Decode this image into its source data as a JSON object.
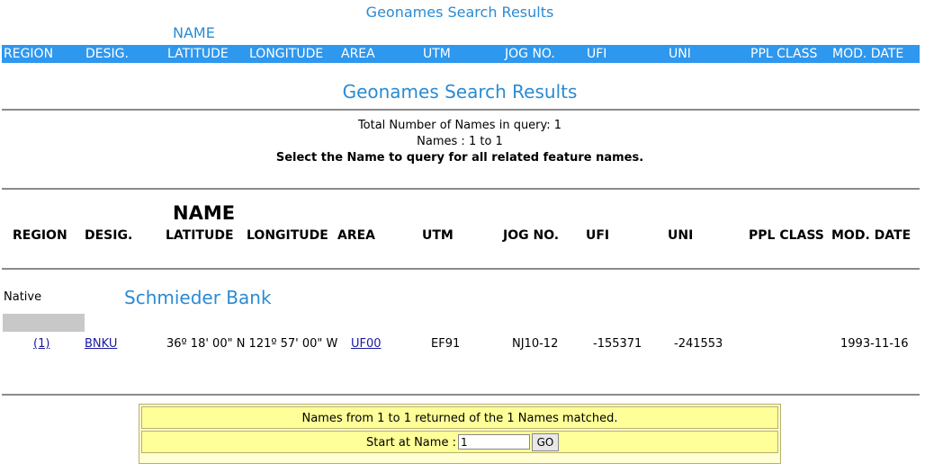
{
  "top": {
    "title": "Geonames Search Results",
    "name_label": "NAME",
    "columns": [
      "REGION",
      "DESIG.",
      "LATITUDE",
      "LONGITUDE",
      "AREA",
      "UTM",
      "JOG NO.",
      "UFI",
      "UNI",
      "PPL CLASS",
      "MOD. DATE"
    ]
  },
  "main": {
    "title": "Geonames Search Results",
    "total_names": "Total Number of Names in query: 1",
    "names_range": "Names : 1 to 1",
    "instruction": "Select the Name to query for all related feature names."
  },
  "headers": {
    "name": "NAME",
    "region": "REGION",
    "desig": "DESIG.",
    "latitude": "LATITUDE",
    "longitude": "LONGITUDE",
    "area": "AREA",
    "utm": "UTM",
    "jog": "JOG NO.",
    "ufi": "UFI",
    "uni": "UNI",
    "ppl": "PPL CLASS",
    "mod": "MOD. DATE"
  },
  "result": {
    "native_label": "Native",
    "feature_name": "Schmieder Bank",
    "index": "(1)",
    "desig": "BNKU",
    "lat_long": "36º 18' 00\" N 121º 57' 00\" W",
    "area": "UF00",
    "utm": "EF91",
    "jog": "NJ10-12",
    "ufi": "-155371",
    "uni": "-241553",
    "mod_date": "1993-11-16"
  },
  "pager": {
    "summary": "Names from 1 to 1 returned of the 1 Names matched.",
    "start_label": "Start at Name :",
    "start_value": "1",
    "go_label": "GO"
  },
  "colors": {
    "title_blue": "#2a8bd2",
    "header_bar": "#2e97ee",
    "pager_bg": "#ffff99"
  }
}
